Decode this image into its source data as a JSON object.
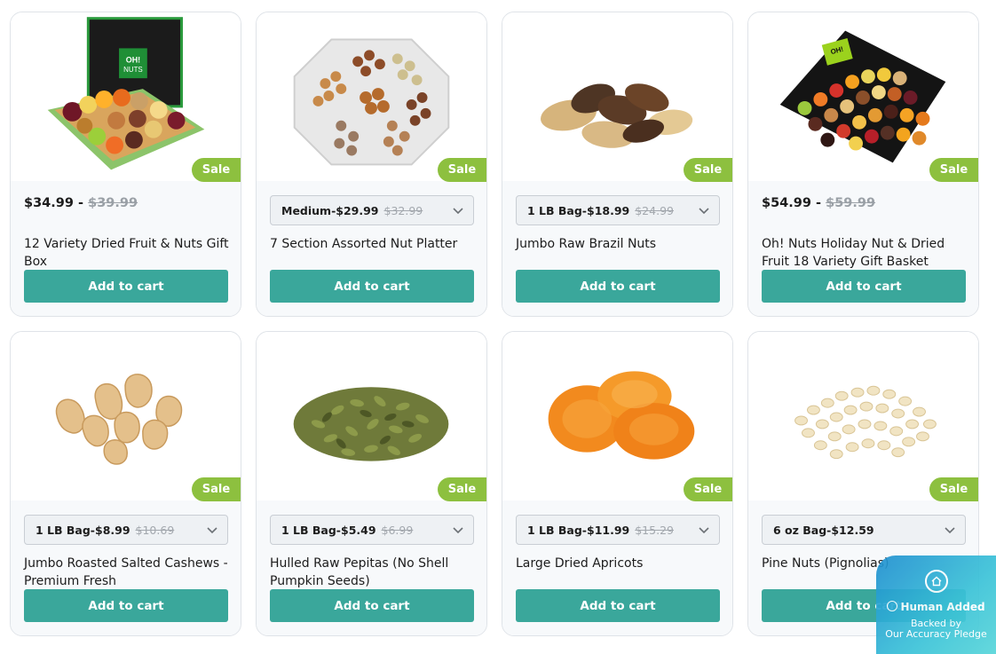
{
  "products": [
    {
      "title": "12 Variety Dried Fruit & Nuts Gift Box",
      "sale_label": "Sale",
      "price": "$34.99",
      "separator": "-",
      "old_price": "$39.99",
      "button": "Add to cart",
      "image": "dried-fruit-nuts-gift-box"
    },
    {
      "title": "7 Section Assorted Nut Platter",
      "sale_label": "Sale",
      "variant": "Medium-$29.99",
      "old_price": "$32.99",
      "button": "Add to cart",
      "image": "assorted-nut-platter"
    },
    {
      "title": "Jumbo Raw Brazil Nuts",
      "sale_label": "Sale",
      "variant": "1 LB Bag-$18.99",
      "old_price": "$24.99",
      "button": "Add to cart",
      "image": "brazil-nuts"
    },
    {
      "title": "Oh! Nuts Holiday Nut & Dried Fruit 18 Variety Gift Basket",
      "sale_label": "Sale",
      "price": "$54.99",
      "separator": "-",
      "old_price": "$59.99",
      "button": "Add to cart",
      "image": "holiday-gift-basket"
    },
    {
      "title": "Jumbo Roasted Salted Cashews - Premium Fresh",
      "sale_label": "Sale",
      "variant": "1 LB Bag-$8.99",
      "old_price": "$10.69",
      "button": "Add to cart",
      "image": "cashews"
    },
    {
      "title": "Hulled Raw Pepitas (No Shell Pumpkin Seeds)",
      "sale_label": "Sale",
      "variant": "1 LB Bag-$5.49",
      "old_price": "$6.99",
      "button": "Add to cart",
      "image": "pepitas"
    },
    {
      "title": "Large Dried Apricots",
      "sale_label": "Sale",
      "variant": "1 LB Bag-$11.99",
      "old_price": "$15.29",
      "button": "Add to cart",
      "image": "dried-apricots"
    },
    {
      "title": "Pine Nuts (Pignolias)",
      "sale_label": "Sale",
      "variant": "6 oz Bag-$12.59",
      "old_price": "",
      "button": "Add to cart",
      "image": "pine-nuts"
    }
  ],
  "trust_badge": {
    "line1": "Human Added",
    "line2": "Backed by",
    "line3": "Our Accuracy Pledge"
  },
  "colors": {
    "sale_badge": "#8dc03f",
    "add_to_cart": "#3aa79b",
    "strikethrough": "#9aa0a6"
  }
}
